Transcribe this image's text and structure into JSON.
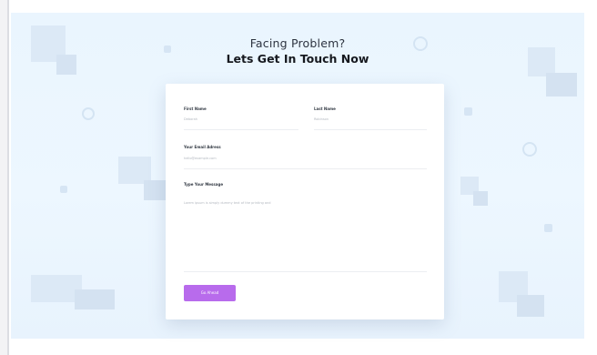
{
  "heading": {
    "subtitle": "Facing Problem?",
    "title": "Lets Get In Touch Now"
  },
  "form": {
    "first_name": {
      "label": "First Name",
      "placeholder": "Deborah"
    },
    "last_name": {
      "label": "Last Name",
      "placeholder": "Robinson"
    },
    "email": {
      "label": "Your Email Adress",
      "placeholder": "hello@example.com"
    },
    "message": {
      "label": "Type Your Message",
      "placeholder": "Lorem ipsum is simply dummy text of the printing and"
    },
    "submit_label": "Go Ahead"
  },
  "colors": {
    "accent": "#b86bec",
    "background": "#eaf5fe",
    "card": "#ffffff"
  }
}
